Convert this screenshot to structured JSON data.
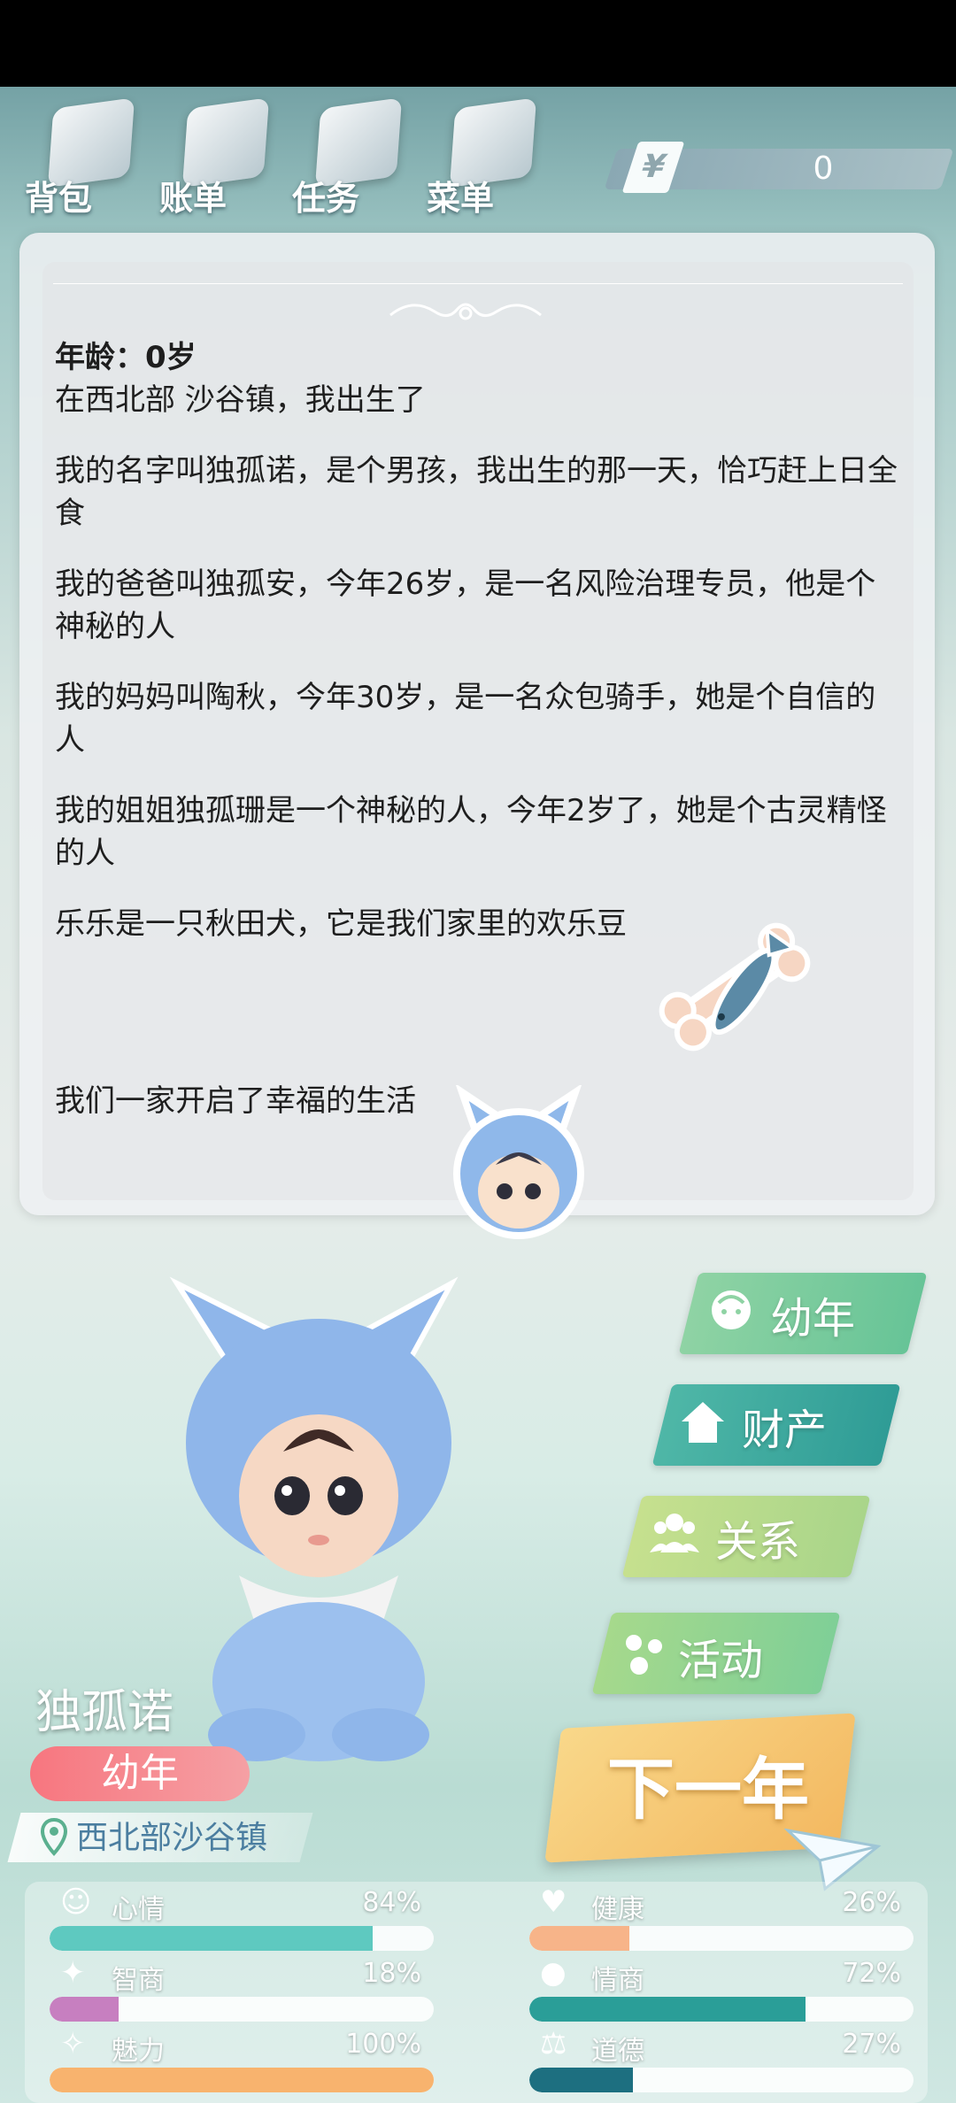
{
  "menu": {
    "items": [
      {
        "label": "背包",
        "icon": "backpack-icon"
      },
      {
        "label": "账单",
        "icon": "bill-icon"
      },
      {
        "label": "任务",
        "icon": "task-icon"
      },
      {
        "label": "菜单",
        "icon": "menu-icon"
      }
    ]
  },
  "money": {
    "symbol": "¥",
    "value": "0"
  },
  "story": {
    "age_line": "年龄：0岁",
    "lines": [
      "在西北部 沙谷镇，我出生了",
      "我的名字叫独孤诺，是个男孩，我出生的那一天，恰巧赶上日全食",
      "我的爸爸叫独孤安，今年26岁，是一名风险治理专员，他是个神秘的人",
      "我的妈妈叫陶秋，今年30岁，是一名众包骑手，她是个自信的人",
      "我的姐姐独孤珊是一个神秘的人，今年2岁了，她是个古灵精怪的人",
      "乐乐是一只秋田犬，它是我们家里的欢乐豆",
      "我们一家开启了幸福的生活"
    ]
  },
  "character": {
    "name": "独孤诺",
    "stage": "幼年",
    "location": "西北部沙谷镇"
  },
  "actions": {
    "stage": "幼年",
    "assets": "财产",
    "relations": "关系",
    "activities": "活动",
    "next_year": "下一年"
  },
  "colors": {
    "stage_btn": "#7fcf9a",
    "assets_btn": "#3aa79c",
    "relations_btn": "#b8d98a",
    "activities_btn": "#8fcf98",
    "next_year": "#f3c46c"
  },
  "stats": [
    {
      "name": "心情",
      "value": "84%",
      "fraction": 0.84,
      "color": "#5ec9c0",
      "icon": "smile-icon"
    },
    {
      "name": "健康",
      "value": "26%",
      "fraction": 0.26,
      "color": "#f7b489",
      "icon": "heart-icon"
    },
    {
      "name": "智商",
      "value": "18%",
      "fraction": 0.18,
      "color": "#c77fc0",
      "icon": "bulb-icon"
    },
    {
      "name": "情商",
      "value": "72%",
      "fraction": 0.72,
      "color": "#2a9e98",
      "icon": "apple-icon"
    },
    {
      "name": "魅力",
      "value": "100%",
      "fraction": 1.0,
      "color": "#f8b36e",
      "icon": "sparkle-icon"
    },
    {
      "name": "道德",
      "value": "27%",
      "fraction": 0.27,
      "color": "#1d6f80",
      "icon": "scale-icon"
    }
  ]
}
